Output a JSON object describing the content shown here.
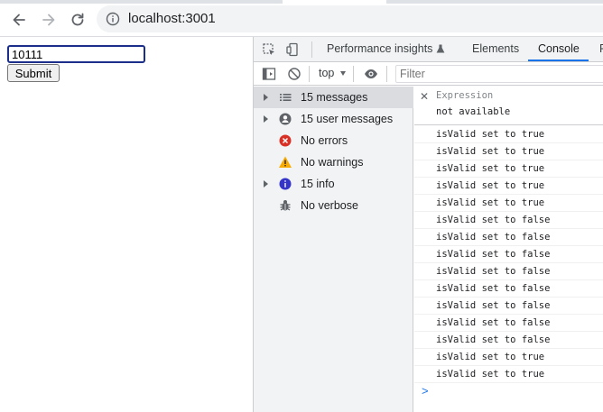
{
  "browser": {
    "url": "localhost:3001",
    "back_icon": "arrow-left-icon",
    "forward_icon": "arrow-right-icon",
    "reload_icon": "reload-icon",
    "info_icon": "info-icon"
  },
  "page": {
    "input_value": "10111",
    "submit_label": "Submit"
  },
  "devtools": {
    "tabs": [
      {
        "label": "Performance insights",
        "active": false
      },
      {
        "label": "Elements",
        "active": false
      },
      {
        "label": "Console",
        "active": true
      },
      {
        "label": "F",
        "active": false
      }
    ],
    "context": "top",
    "filter_placeholder": "Filter",
    "sidebar": [
      {
        "label": "15 messages",
        "icon": "list-icon",
        "expandable": true,
        "selected": true
      },
      {
        "label": "15 user messages",
        "icon": "user-icon",
        "expandable": true,
        "selected": false
      },
      {
        "label": "No errors",
        "icon": "error-icon",
        "expandable": false,
        "selected": false
      },
      {
        "label": "No warnings",
        "icon": "warning-icon",
        "expandable": false,
        "selected": false
      },
      {
        "label": "15 info",
        "icon": "info-icon",
        "expandable": true,
        "selected": false
      },
      {
        "label": "No verbose",
        "icon": "bug-icon",
        "expandable": false,
        "selected": false
      }
    ],
    "expression": {
      "title": "Expression",
      "value": "not available"
    },
    "logs": [
      "isValid set to true",
      "isValid set to true",
      "isValid set to true",
      "isValid set to true",
      "isValid set to true",
      "isValid set to false",
      "isValid set to false",
      "isValid set to false",
      "isValid set to false",
      "isValid set to false",
      "isValid set to false",
      "isValid set to false",
      "isValid set to false",
      "isValid set to true",
      "isValid set to true"
    ],
    "prompt": ">"
  },
  "colors": {
    "accent": "#1a73e8",
    "error": "#d93025",
    "warning": "#f9ab00",
    "info": "#3535c8"
  }
}
